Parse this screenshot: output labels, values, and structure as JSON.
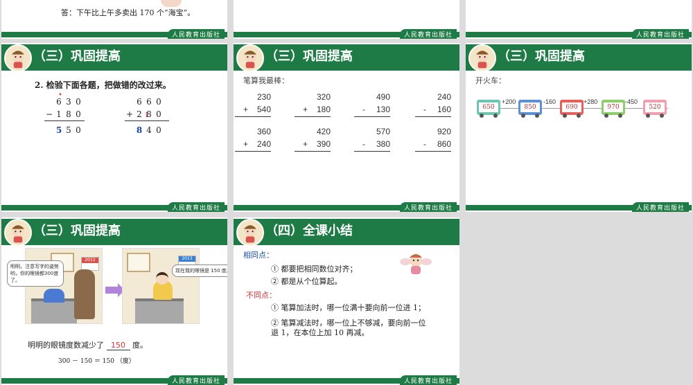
{
  "slides": {
    "s1": {
      "answer": "答：下午比上午多卖出 170 个“海宝”。"
    },
    "s4": {
      "title": "（三）巩固提高",
      "question": "2. 检验下面各题，把做错的改过来。",
      "calc1": {
        "top": [
          "6",
          "3",
          "0"
        ],
        "op": "−",
        "bottom": [
          "1",
          "8",
          "0"
        ],
        "result": [
          "5",
          "5",
          "0"
        ],
        "dot": "•"
      },
      "calc2": {
        "top": [
          "6",
          "6",
          "0"
        ],
        "op": "+",
        "bottom": [
          "2",
          "8",
          "0"
        ],
        "result": [
          "8",
          "4",
          "0"
        ],
        "mark": "1"
      }
    },
    "s5": {
      "title": "（三）巩固提高",
      "intro": "笔算我最棒：",
      "problems": [
        {
          "a": "230",
          "op": "+",
          "b": "540"
        },
        {
          "a": "320",
          "op": "+",
          "b": "180"
        },
        {
          "a": "490",
          "op": "-",
          "b": "130"
        },
        {
          "a": "240",
          "op": "-",
          "b": "160"
        },
        {
          "a": "360",
          "op": "+",
          "b": "240"
        },
        {
          "a": "420",
          "op": "+",
          "b": "390"
        },
        {
          "a": "570",
          "op": "-",
          "b": "380"
        },
        {
          "a": "920",
          "op": "-",
          "b": "860"
        }
      ]
    },
    "s6": {
      "title": "（三）巩固提高",
      "intro": "开火车：",
      "cars": [
        "650",
        "850",
        "690",
        "970",
        "520"
      ],
      "ops": [
        "+200",
        "-160",
        "+280",
        "-450"
      ],
      "car_colors": [
        "#6cc5b0",
        "#5b8fd6",
        "#e8605a",
        "#8ccf6a",
        "#f2a0b0"
      ]
    },
    "s7": {
      "title": "（三）巩固提高",
      "bubble1": "明明，注意写字的姿势哟，你的眼镜都300度了。",
      "bubble2": "现在我的眼镜是 150 度。",
      "year1": "2012",
      "year2": "2013",
      "sentence_pre": "明明的眼镜度数减少了",
      "blank": "150",
      "sentence_post": "度。",
      "equation": "300 － 150 ＝ 150 （度）"
    },
    "s8": {
      "title": "（四）全课小结",
      "same_label": "相同点：",
      "same": [
        "① 都要把相同数位对齐；",
        "② 都是从个位算起。"
      ],
      "diff_label": "不同点：",
      "diff": [
        "① 笔算加法时，哪一位满十要向前一位进 1；",
        "② 笔算减法时，哪一位上不够减，要向前一位",
        "退 1，在本位上加 10 再减。"
      ]
    },
    "footer_text": "人民教育出版社"
  }
}
